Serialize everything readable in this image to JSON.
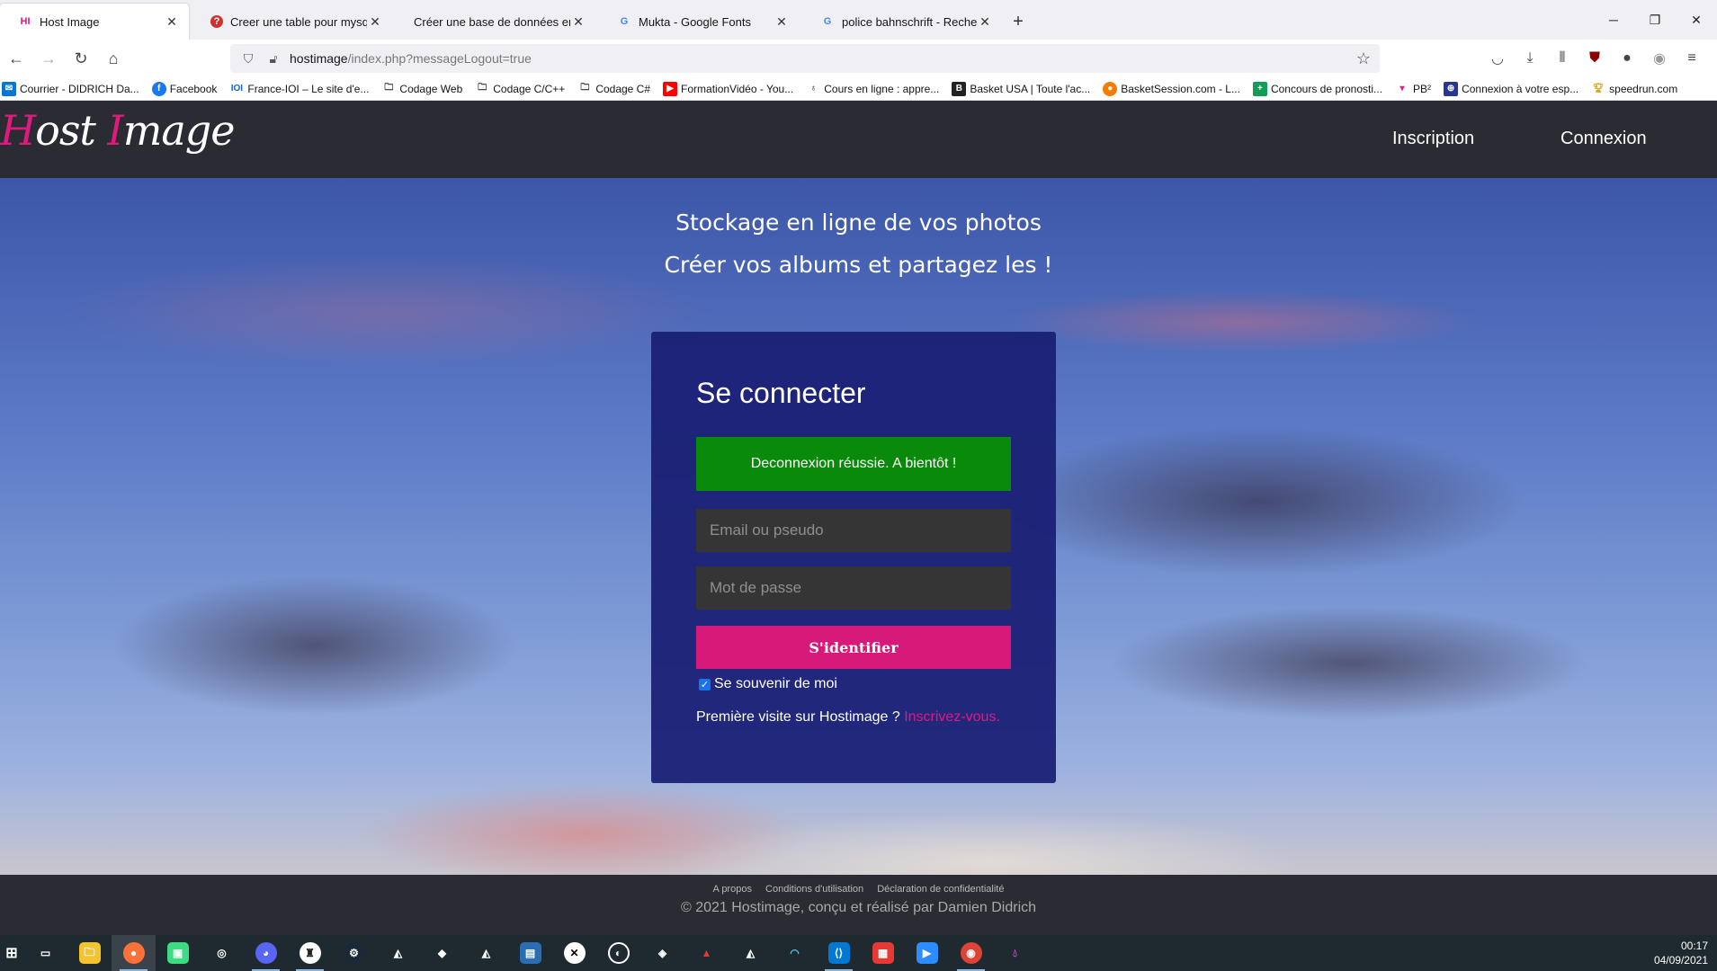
{
  "browser": {
    "tabs": [
      {
        "title": "Host Image",
        "favicon": "HI",
        "active": true
      },
      {
        "title": "Creer une table pour mysql avec",
        "favicon": "?"
      },
      {
        "title": "Créer une base de données en php",
        "favicon": ""
      },
      {
        "title": "Mukta - Google Fonts",
        "favicon": "G"
      },
      {
        "title": "police bahnschrift - Recherche G",
        "favicon": "G"
      }
    ],
    "new_tab_label": "+",
    "url_host": "hostimage",
    "url_path": "/index.php?messageLogout=true",
    "bookmarks": [
      {
        "label": "Courrier - DIDRICH Da...",
        "icon": "mail-icon"
      },
      {
        "label": "Facebook",
        "icon": "facebook-icon"
      },
      {
        "label": "France-IOI – Le site d'e...",
        "icon": "franceioi-icon"
      },
      {
        "label": "Codage Web",
        "icon": "folder-icon"
      },
      {
        "label": "Codage C/C++",
        "icon": "folder-icon"
      },
      {
        "label": "Codage C#",
        "icon": "folder-icon"
      },
      {
        "label": "FormationVidéo - You...",
        "icon": "youtube-icon"
      },
      {
        "label": "Cours en ligne : appre...",
        "icon": "course-icon"
      },
      {
        "label": "Basket USA | Toute l'ac...",
        "icon": "basket-icon"
      },
      {
        "label": "BasketSession.com - L...",
        "icon": "ball-icon"
      },
      {
        "label": "Concours de pronosti...",
        "icon": "plus-icon"
      },
      {
        "label": "PB²",
        "icon": "pb-icon"
      },
      {
        "label": "Connexion à votre esp...",
        "icon": "tx-icon"
      },
      {
        "label": "speedrun.com",
        "icon": "trophy-icon"
      }
    ]
  },
  "site": {
    "logo_first": "H",
    "logo_mid1": "ost ",
    "logo_second": "I",
    "logo_mid2": "mage",
    "nav_signup": "Inscription",
    "nav_login": "Connexion",
    "hero_line1": "Stockage en ligne de vos photos",
    "hero_line2": "Créer vos albums et partagez les !",
    "form": {
      "title": "Se connecter",
      "alert": "Deconnexion réussie. A bientôt !",
      "email_placeholder": "Email ou pseudo",
      "password_placeholder": "Mot de passe",
      "submit": "S'identifier",
      "remember_label": "Se souvenir de moi",
      "remember_checked": true,
      "first_visit_text": "Première visite sur Hostimage ? ",
      "signup_link": "Inscrivez-vous",
      "signup_suffix": "."
    },
    "footer": {
      "links": [
        "A propos",
        "Conditions d'utilisation",
        "Déclaration de confidentialité"
      ],
      "copyright": "© 2021 Hostimage, conçu et réalisé par Damien Didrich"
    },
    "colors": {
      "accent": "#e0197d",
      "header_bg": "#2a2b33",
      "card_bg": "#191e73",
      "alert_bg": "#0a8a0a",
      "button_bg": "#d7197a"
    }
  },
  "taskbar": {
    "time": "00:17",
    "date": "04/09/2021"
  }
}
